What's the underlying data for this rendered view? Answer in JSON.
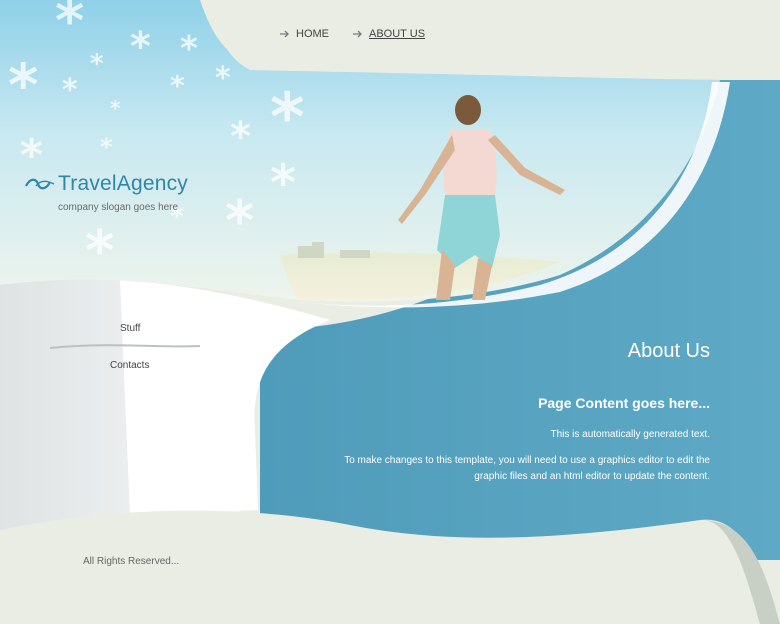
{
  "nav": {
    "items": [
      {
        "label": "HOME",
        "active": false
      },
      {
        "label": "ABOUT US",
        "active": true
      }
    ]
  },
  "brand": {
    "name": "TravelAgency",
    "slogan": "company slogan goes here",
    "color": "#2f87a7"
  },
  "sidebar": {
    "links": [
      "Stuff",
      "Contacts"
    ]
  },
  "main": {
    "title": "About Us",
    "heading": "Page Content goes here...",
    "paragraph1": "This is automatically generated text.",
    "paragraph2": "To make changes to this template, you will need to use a graphics editor to edit the graphic files and an html editor to update the content."
  },
  "footer": {
    "text": "All Rights Reserved..."
  },
  "colors": {
    "accent_blue": "#5ba7c3",
    "sky": "#8dcfe6",
    "cream": "#eaede3",
    "text": "#444444"
  }
}
